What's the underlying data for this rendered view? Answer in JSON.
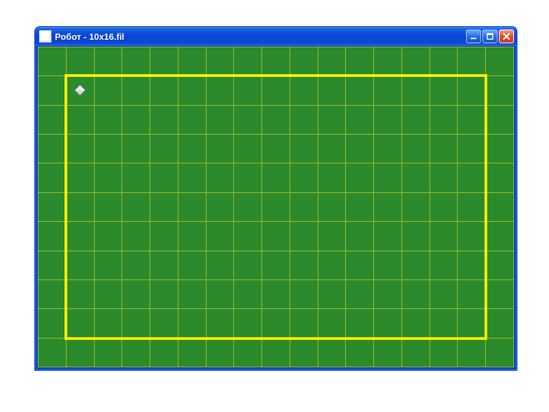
{
  "window": {
    "title": "Робот - 10x16.fil"
  },
  "controls": {
    "minimize_name": "minimize",
    "maximize_name": "maximize",
    "close_name": "close"
  },
  "field": {
    "rows": 11,
    "cols": 17,
    "grid_color": "#9fbf2e",
    "bg_color": "#2b8a2b",
    "wall_color": "#ffee00",
    "wall_rect": {
      "left_col": 1,
      "top_row": 1,
      "right_col": 16,
      "bottom_row": 10
    },
    "robot": {
      "col": 1,
      "row": 1
    }
  }
}
